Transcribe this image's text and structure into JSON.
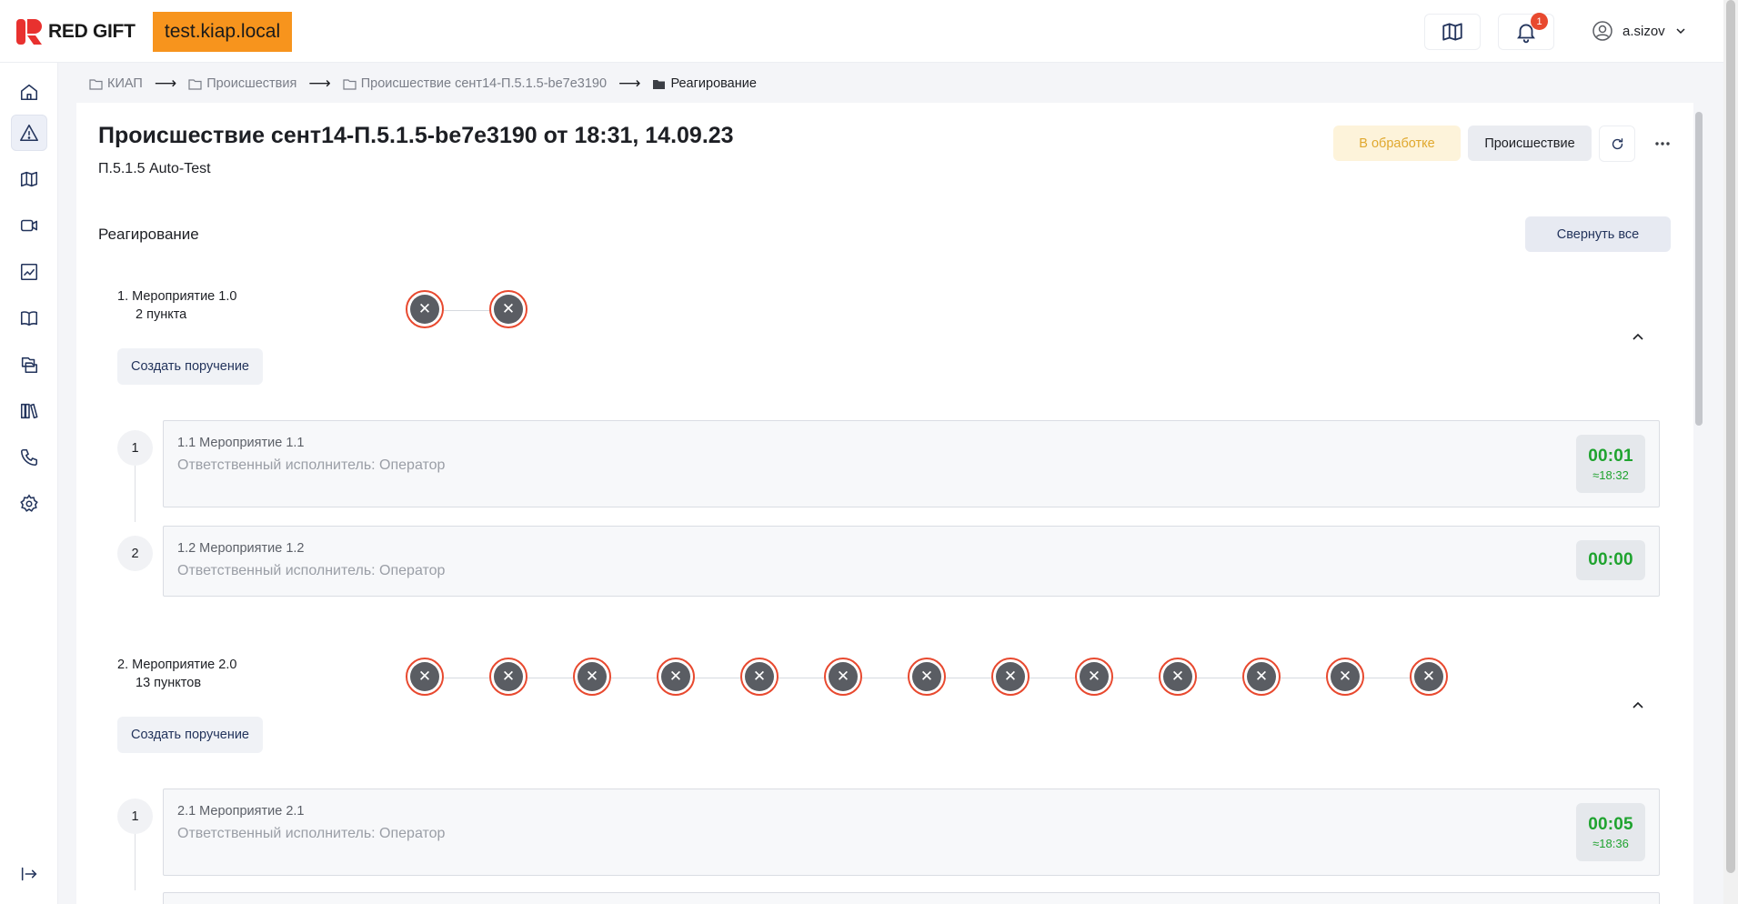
{
  "header": {
    "logo_text": "RED GIFT",
    "host_badge": "test.kiap.local",
    "notifications_count": "1",
    "username": "a.sizov"
  },
  "sidebar": {
    "items": [
      {
        "icon": "home-icon"
      },
      {
        "icon": "warning-icon",
        "active": true
      },
      {
        "icon": "map-icon"
      },
      {
        "icon": "video-camera-icon"
      },
      {
        "icon": "chart-icon"
      },
      {
        "icon": "book-icon"
      },
      {
        "icon": "documents-icon"
      },
      {
        "icon": "library-icon"
      },
      {
        "icon": "phone-icon"
      },
      {
        "icon": "gear-icon"
      }
    ],
    "logout_icon": "logout-icon"
  },
  "breadcrumb": {
    "items": [
      "КИАП",
      "Происшествия",
      "Происшествие сент14-П.5.1.5-be7e3190",
      "Реагирование"
    ]
  },
  "page": {
    "title": "Происшествие сент14-П.5.1.5-be7e3190 от 18:31, 14.09.23",
    "subtitle": "П.5.1.5 Auto-Test",
    "status_label": "В обработке",
    "type_label": "Происшествие",
    "status_color": "#e0a82e"
  },
  "response": {
    "title": "Реагирование",
    "collapse_all_label": "Свернуть все",
    "create_task_label": "Создать поручение",
    "events": [
      {
        "name": "1. Мероприятие 1.0",
        "count": "2 пункта",
        "step_count": 2,
        "tasks": [
          {
            "num": "1",
            "title": "1.1 Мероприятие 1.1",
            "executor": "Ответственный исполнитель: Оператор",
            "timer": "00:01",
            "eta": "≈18:32"
          },
          {
            "num": "2",
            "title": "1.2 Мероприятие 1.2",
            "executor": "Ответственный исполнитель: Оператор",
            "timer": "00:00",
            "eta": ""
          }
        ]
      },
      {
        "name": "2. Мероприятие 2.0",
        "count": "13 пунктов",
        "step_count": 13,
        "tasks": [
          {
            "num": "1",
            "title": "2.1 Мероприятие 2.1",
            "executor": "Ответственный исполнитель: Оператор",
            "timer": "00:05",
            "eta": "≈18:36"
          }
        ]
      }
    ]
  },
  "colors": {
    "accent_orange": "#f7941d",
    "step_border": "#e8492f",
    "timer_green": "#1fa32f"
  }
}
